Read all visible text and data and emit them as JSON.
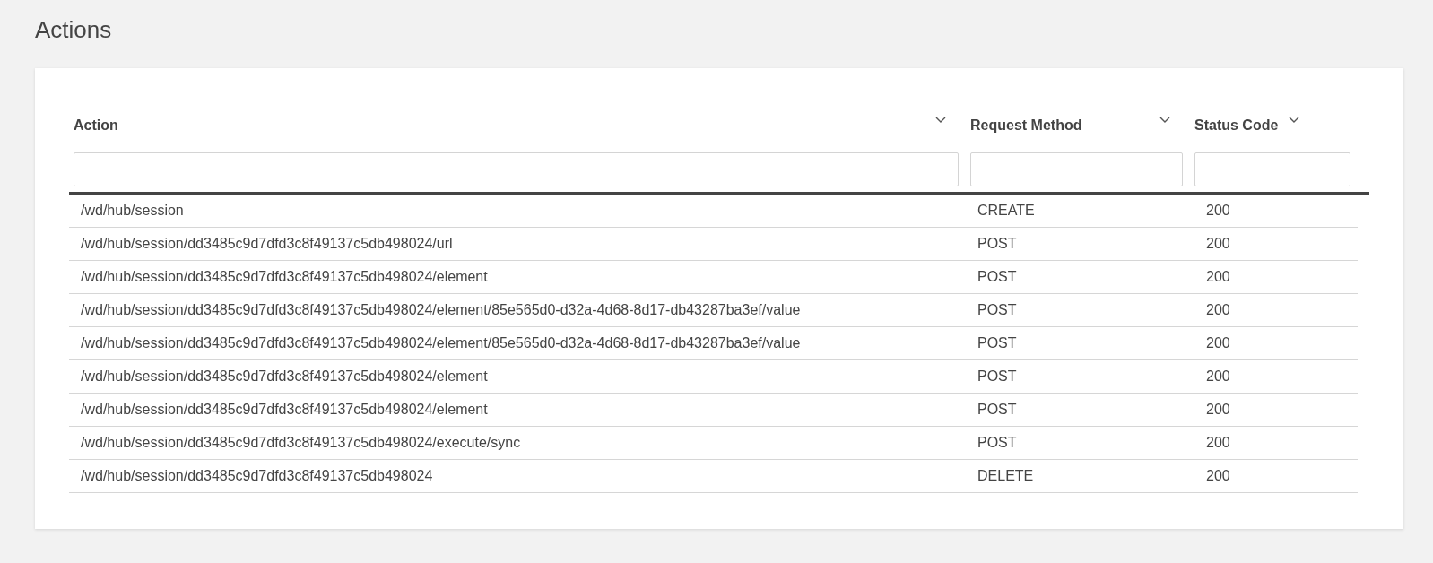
{
  "page_title": "Actions",
  "table": {
    "columns": [
      "Action",
      "Request Method",
      "Status Code"
    ],
    "rows": [
      {
        "action": "/wd/hub/session",
        "method": "CREATE",
        "status": "200"
      },
      {
        "action": "/wd/hub/session/dd3485c9d7dfd3c8f49137c5db498024/url",
        "method": "POST",
        "status": "200"
      },
      {
        "action": "/wd/hub/session/dd3485c9d7dfd3c8f49137c5db498024/element",
        "method": "POST",
        "status": "200"
      },
      {
        "action": "/wd/hub/session/dd3485c9d7dfd3c8f49137c5db498024/element/85e565d0-d32a-4d68-8d17-db43287ba3ef/value",
        "method": "POST",
        "status": "200"
      },
      {
        "action": "/wd/hub/session/dd3485c9d7dfd3c8f49137c5db498024/element/85e565d0-d32a-4d68-8d17-db43287ba3ef/value",
        "method": "POST",
        "status": "200"
      },
      {
        "action": "/wd/hub/session/dd3485c9d7dfd3c8f49137c5db498024/element",
        "method": "POST",
        "status": "200"
      },
      {
        "action": "/wd/hub/session/dd3485c9d7dfd3c8f49137c5db498024/element",
        "method": "POST",
        "status": "200"
      },
      {
        "action": "/wd/hub/session/dd3485c9d7dfd3c8f49137c5db498024/execute/sync",
        "method": "POST",
        "status": "200"
      },
      {
        "action": "/wd/hub/session/dd3485c9d7dfd3c8f49137c5db498024",
        "method": "DELETE",
        "status": "200"
      }
    ]
  }
}
